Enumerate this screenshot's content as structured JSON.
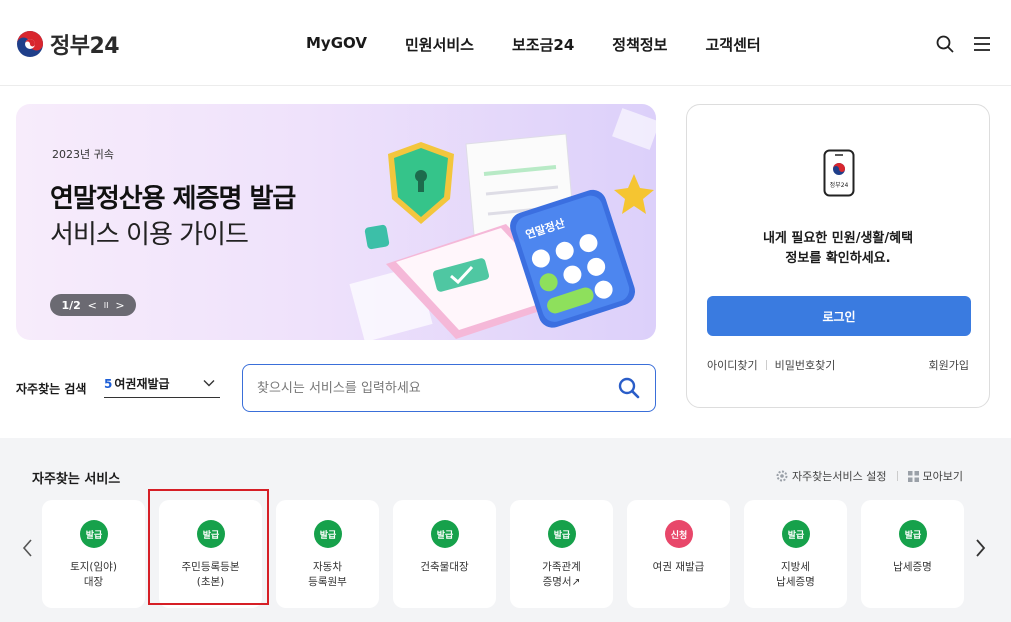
{
  "header": {
    "logo_text": "정부24",
    "nav": [
      "MyGOV",
      "민원서비스",
      "보조금24",
      "정책정보",
      "고객센터"
    ],
    "icons": [
      "search-icon",
      "menu-icon"
    ]
  },
  "banner": {
    "small": "2023년 귀속",
    "title": "연말정산용 제증명 발급",
    "subtitle": "서비스 이용 가이드",
    "pager": {
      "label": "1/2",
      "prev": "<",
      "pause": "II",
      "next": ">"
    },
    "calc_label": "연말정산"
  },
  "search": {
    "label": "자주찾는 검색",
    "select_num": "5",
    "select_text": "여권재발급",
    "placeholder": "찾으시는 서비스를 입력하세요"
  },
  "login": {
    "phone_label": "정부24",
    "message_line1": "내게 필요한 민원/생활/혜택",
    "message_line2": "정보를 확인하세요.",
    "button": "로그인",
    "find_id": "아이디찾기",
    "find_pw": "비밀번호찾기",
    "join": "회원가입"
  },
  "services": {
    "title": "자주찾는 서비스",
    "settings": "자주찾는서비스 설정",
    "view_all": "모아보기",
    "items": [
      {
        "badge": "발급",
        "label": "토지(임야)\n대장",
        "color": "#16a14b"
      },
      {
        "badge": "발급",
        "label": "주민등록등본\n(초본)",
        "color": "#16a14b"
      },
      {
        "badge": "발급",
        "label": "자동차\n등록원부",
        "color": "#16a14b"
      },
      {
        "badge": "발급",
        "label": "건축물대장",
        "color": "#16a14b"
      },
      {
        "badge": "발급",
        "label": "가족관계\n증명서↗",
        "color": "#16a14b"
      },
      {
        "badge": "신청",
        "label": "여권 재발급",
        "color": "#e8476a"
      },
      {
        "badge": "발급",
        "label": "지방세\n납세증명",
        "color": "#16a14b"
      },
      {
        "badge": "발급",
        "label": "납세증명",
        "color": "#16a14b"
      }
    ]
  },
  "colors": {
    "accent": "#3a7be0",
    "issue": "#16a14b",
    "apply": "#e8476a",
    "highlight": "#d61f26"
  }
}
